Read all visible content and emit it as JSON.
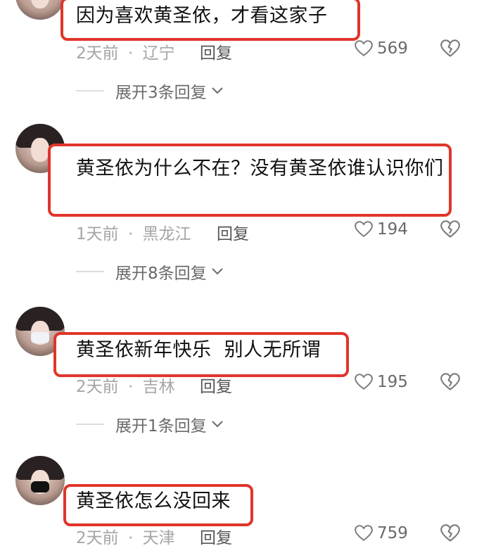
{
  "comments": [
    {
      "text": "因为喜欢黄圣依，才看这家子",
      "time": "2天前",
      "location": "辽宁",
      "reply_label": "回复",
      "likes": "569",
      "expand_label": "展开3条回复"
    },
    {
      "text": "黄圣依为什么不在？没有黄圣依谁认识你们",
      "time": "1天前",
      "location": "黑龙江",
      "reply_label": "回复",
      "likes": "194",
      "expand_label": "展开8条回复"
    },
    {
      "text": "黄圣依新年快乐  别人无所谓",
      "time": "2天前",
      "location": "吉林",
      "reply_label": "回复",
      "likes": "195",
      "expand_label": "展开1条回复"
    },
    {
      "text": "黄圣依怎么没回来",
      "time": "2天前",
      "location": "天津",
      "reply_label": "回复",
      "likes": "759"
    }
  ],
  "meta_separator": "·",
  "colors": {
    "highlight_border": "#e0352b",
    "meta_text": "#a5a5a5",
    "body_text": "#111111"
  },
  "icons": {
    "like": "heart-outline-icon",
    "dislike": "broken-heart-icon",
    "expand": "chevron-down-icon"
  }
}
